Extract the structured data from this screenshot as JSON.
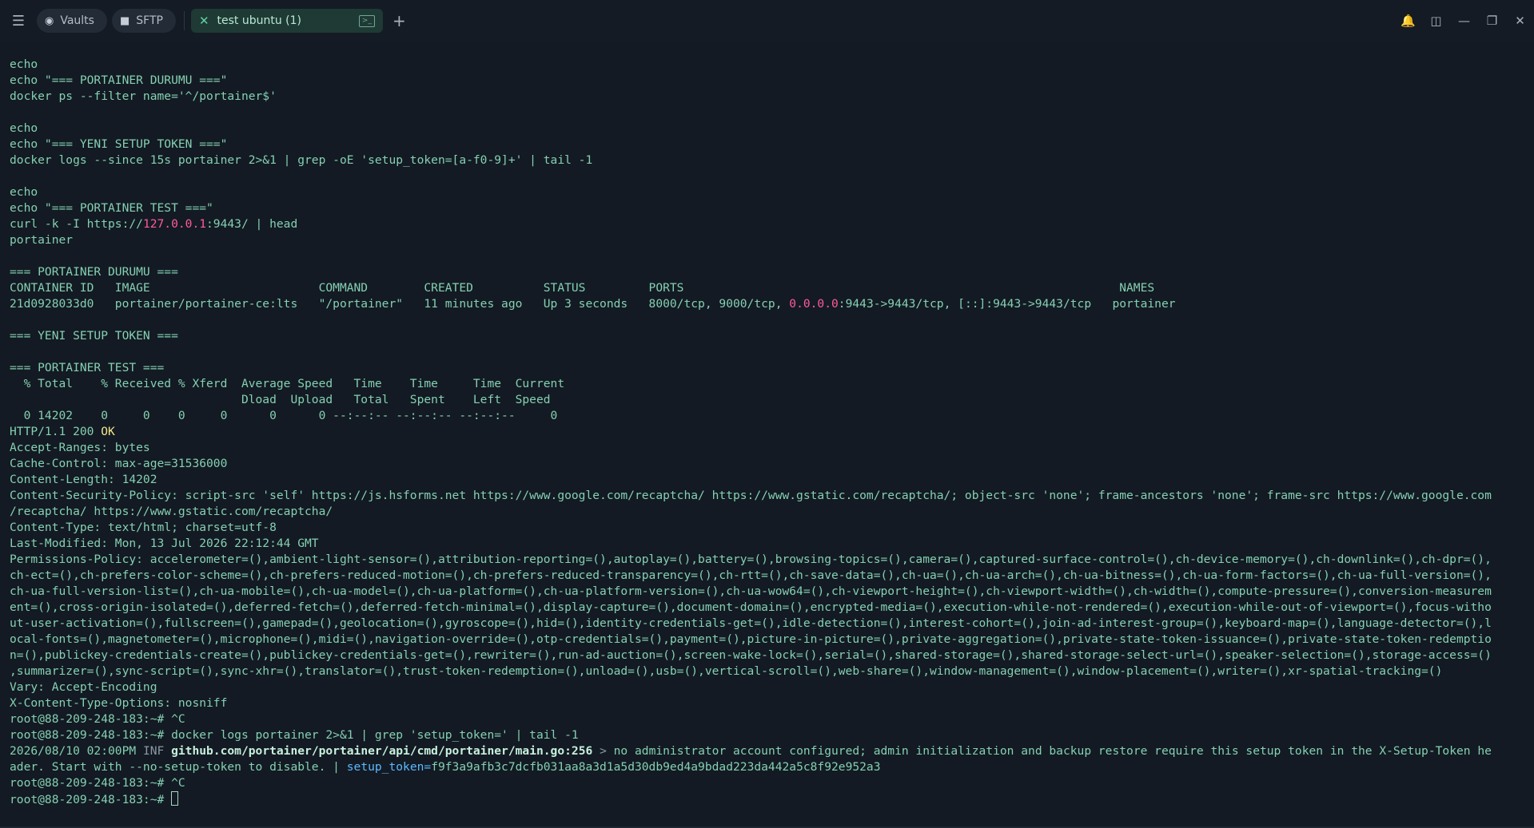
{
  "topbar": {
    "vaults_label": "Vaults",
    "sftp_label": "SFTP",
    "tab_label": "test ubuntu (1)"
  },
  "terminal": {
    "lines": [
      "echo",
      "echo \"=== PORTAINER DURUMU ===\"",
      "docker ps --filter name='^/portainer$'",
      "",
      "echo",
      "echo \"=== YENI SETUP TOKEN ===\"",
      "docker logs --since 15s portainer 2>&1 | grep -oE 'setup_token=[a-f0-9]+' | tail -1",
      "",
      "echo",
      "echo \"=== PORTAINER TEST ===\"",
      "curl -k -I https://[[127.0.0.1]]:9443/ | head",
      "portainer",
      "",
      "=== PORTAINER DURUMU ===",
      "CONTAINER ID   IMAGE                        COMMAND        CREATED          STATUS         PORTS                                                              NAMES",
      "21d0928033d0   portainer/portainer-ce:lts   \"/portainer\"   11 minutes ago   Up 3 seconds   8000/tcp, 9000/tcp, [[0.0.0.0]]:9443->9443/tcp, [::]:9443->9443/tcp   portainer",
      "",
      "=== YENI SETUP TOKEN ===",
      "",
      "=== PORTAINER TEST ===",
      "  % Total    % Received % Xferd  Average Speed   Time    Time     Time  Current",
      "                                 Dload  Upload   Total   Spent    Left  Speed",
      "  0 14202    0     0    0     0      0      0 --:--:-- --:--:-- --:--:--     0",
      "HTTP/1.1 200 {{OK}}",
      "Accept-Ranges: bytes",
      "Cache-Control: max-age=31536000",
      "Content-Length: 14202",
      "Content-Security-Policy: script-src 'self' https://js.hsforms.net https://www.google.com/recaptcha/ https://www.gstatic.com/recaptcha/; object-src 'none'; frame-ancestors 'none'; frame-src https://www.google.com",
      "/recaptcha/ https://www.gstatic.com/recaptcha/",
      "Content-Type: text/html; charset=utf-8",
      "Last-Modified: Mon, 13 Jul 2026 22:12:44 GMT",
      "Permissions-Policy: accelerometer=(),ambient-light-sensor=(),attribution-reporting=(),autoplay=(),battery=(),browsing-topics=(),camera=(),captured-surface-control=(),ch-device-memory=(),ch-downlink=(),ch-dpr=(),",
      "ch-ect=(),ch-prefers-color-scheme=(),ch-prefers-reduced-motion=(),ch-prefers-reduced-transparency=(),ch-rtt=(),ch-save-data=(),ch-ua=(),ch-ua-arch=(),ch-ua-bitness=(),ch-ua-form-factors=(),ch-ua-full-version=(),",
      "ch-ua-full-version-list=(),ch-ua-mobile=(),ch-ua-model=(),ch-ua-platform=(),ch-ua-platform-version=(),ch-ua-wow64=(),ch-viewport-height=(),ch-viewport-width=(),ch-width=(),compute-pressure=(),conversion-measurem",
      "ent=(),cross-origin-isolated=(),deferred-fetch=(),deferred-fetch-minimal=(),display-capture=(),document-domain=(),encrypted-media=(),execution-while-not-rendered=(),execution-while-out-of-viewport=(),focus-witho",
      "ut-user-activation=(),fullscreen=(),gamepad=(),geolocation=(),gyroscope=(),hid=(),identity-credentials-get=(),idle-detection=(),interest-cohort=(),join-ad-interest-group=(),keyboard-map=(),language-detector=(),l",
      "ocal-fonts=(),magnetometer=(),microphone=(),midi=(),navigation-override=(),otp-credentials=(),payment=(),picture-in-picture=(),private-aggregation=(),private-state-token-issuance=(),private-state-token-redemptio",
      "n=(),publickey-credentials-create=(),publickey-credentials-get=(),rewriter=(),run-ad-auction=(),screen-wake-lock=(),serial=(),shared-storage=(),shared-storage-select-url=(),speaker-selection=(),storage-access=()",
      ",summarizer=(),sync-script=(),sync-xhr=(),translator=(),trust-token-redemption=(),unload=(),usb=(),vertical-scroll=(),web-share=(),window-management=(),window-placement=(),writer=(),xr-spatial-tracking=()",
      "Vary: Accept-Encoding",
      "X-Content-Type-Options: nosniff",
      "root@88-209-248-183:~# ^C",
      "root@88-209-248-183:~# docker logs portainer 2>&1 | grep 'setup_token=' | tail -1",
      "2026/08/10 02:00PM <<INF>> ##github.com/portainer/portainer/api/cmd/portainer/main.go:256## <<>>> no administrator account configured; admin initialization and backup restore require this setup token in the X-Setup-Token he",
      "ader. Start with --no-setup-token to disable. | %%setup_token=%%f9f3a9afb3c7dcfb031aa8a3d1a5d30db9ed4a9bdad223da442a5c8f92e952a3",
      "root@88-209-248-183:~# ^C",
      "root@88-209-248-183:~# "
    ]
  }
}
